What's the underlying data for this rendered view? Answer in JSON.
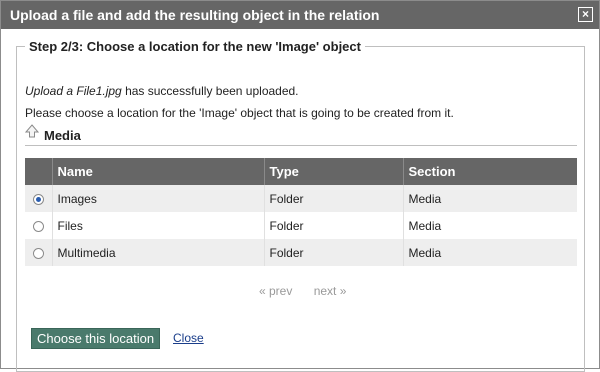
{
  "dialog": {
    "title": "Upload a file and add the resulting object in the relation",
    "close_symbol": "×"
  },
  "step": {
    "legend": "Step 2/3: Choose a location for the new 'Image' object",
    "uploaded_filename": "Upload a File1.jpg",
    "uploaded_suffix": " has successfully been uploaded.",
    "instruction": "Please choose a location for the 'Image' object that is going to be created from it."
  },
  "breadcrumb": {
    "icon": "up-arrow-icon",
    "label": "Media"
  },
  "table": {
    "headers": [
      "",
      "Name",
      "Type",
      "Section"
    ],
    "rows": [
      {
        "selected": true,
        "name": "Images",
        "type": "Folder",
        "section": "Media"
      },
      {
        "selected": false,
        "name": "Files",
        "type": "Folder",
        "section": "Media"
      },
      {
        "selected": false,
        "name": "Multimedia",
        "type": "Folder",
        "section": "Media"
      }
    ]
  },
  "pager": {
    "prev": "« prev",
    "next": "next »"
  },
  "actions": {
    "choose_label": "Choose this location",
    "close_label": "Close"
  },
  "colors": {
    "titlebar_bg": "#666666",
    "header_bg": "#666666",
    "button_bg": "#4a7a6c",
    "link": "#1a3d8a"
  }
}
